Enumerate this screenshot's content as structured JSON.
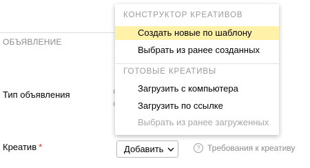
{
  "form": {
    "section_title": "ОБЪЯВЛЕНИЕ",
    "ad_type_label": "Тип объявления",
    "creative_label": "Креатив",
    "required_mark": "*",
    "add_button_label": "Добавить",
    "requirements_link": "Требования к креативу"
  },
  "dropdown": {
    "groups": [
      {
        "header": "КОНСТРУКТОР КРЕАТИВОВ",
        "items": [
          {
            "label": "Создать новые по шаблону",
            "highlighted": true,
            "disabled": false
          },
          {
            "label": "Выбрать из ранее созданных",
            "highlighted": false,
            "disabled": false
          }
        ]
      },
      {
        "header": "ГОТОВЫЕ КРЕАТИВЫ",
        "items": [
          {
            "label": "Загрузить с компьютера",
            "highlighted": false,
            "disabled": false
          },
          {
            "label": "Загрузить по ссылке",
            "highlighted": false,
            "disabled": false
          },
          {
            "label": "Выбрать из ранее загруженных",
            "highlighted": false,
            "disabled": true
          }
        ]
      }
    ]
  },
  "colors": {
    "highlight": "#fff1a8",
    "required": "#e52a2a",
    "muted_text": "#8c8c8c"
  },
  "icons": {
    "add_button": "chevron-down-icon",
    "requirements": "question-circle-icon"
  }
}
